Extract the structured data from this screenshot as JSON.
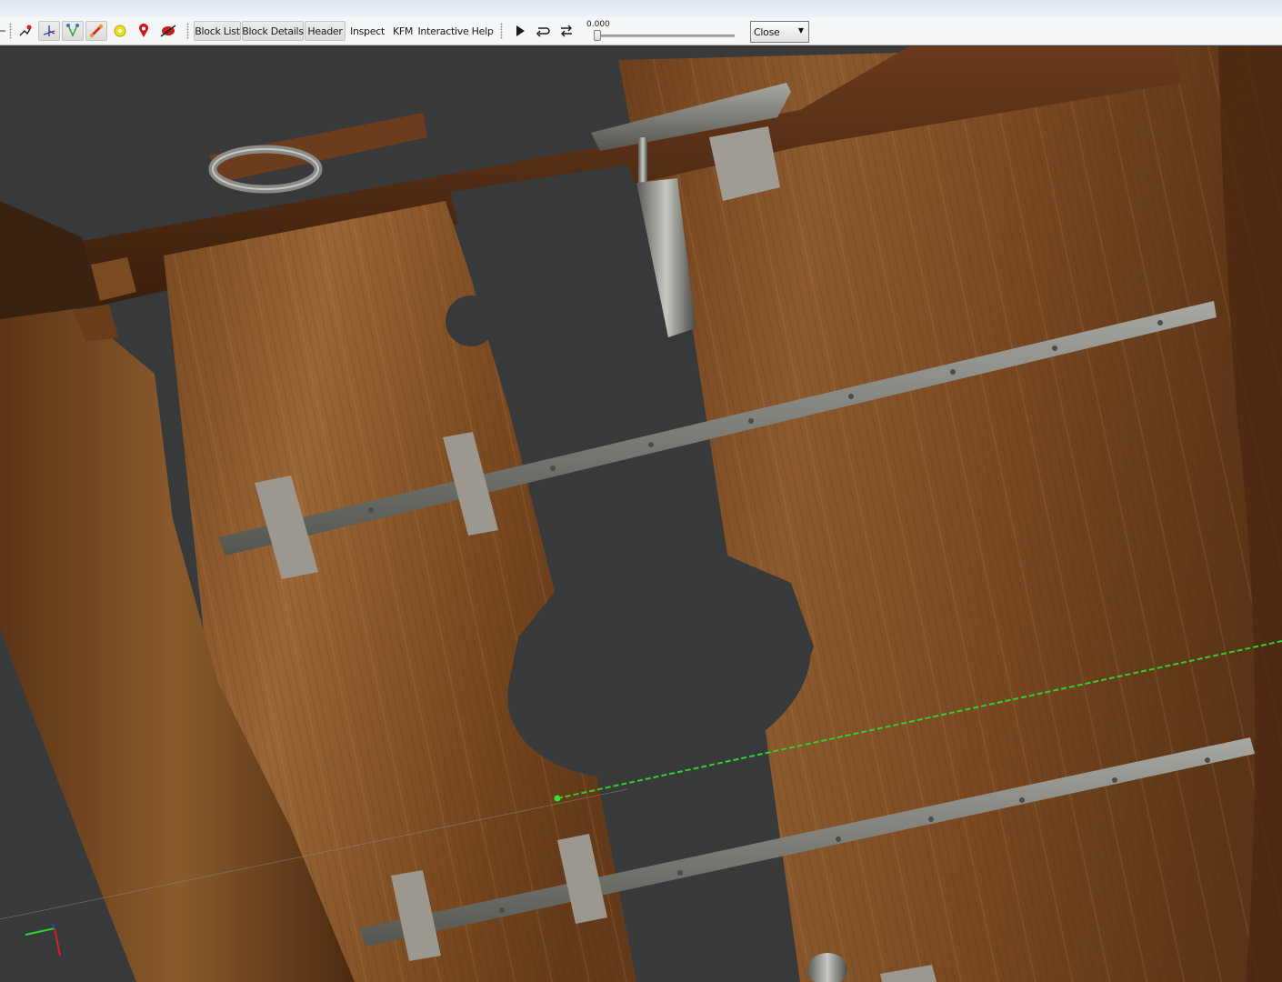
{
  "toolbar": {
    "icons": [
      "move-select-icon",
      "transform-axes-icon",
      "vertex-paint-icon",
      "bone-icon",
      "sun-light-icon",
      "location-pin-icon",
      "collision-icon"
    ],
    "buttons": {
      "block_list": "Block List",
      "block_details": "Block Details",
      "header": "Header",
      "inspect": "Inspect",
      "kfm": "KFM",
      "interactive_help": "Interactive Help"
    },
    "playback_icons": [
      "play-icon",
      "loop-icon",
      "switch-icon"
    ],
    "slider": {
      "value_text": "0.000",
      "fraction": 0.0
    },
    "close_select": {
      "selected": "Close"
    }
  },
  "viewport": {
    "content": "3D render of a wooden pillory / stocks with iron straps",
    "colors": {
      "background": "#3a3a3b",
      "wood_light": "#8a5a30",
      "wood_dark": "#5a3418",
      "metal": "#8f8f8a",
      "guide_line": "#2ed12e",
      "axis_x": "#2bd42b",
      "axis_y": "#d42020",
      "axis_z": "#2040d0"
    }
  }
}
